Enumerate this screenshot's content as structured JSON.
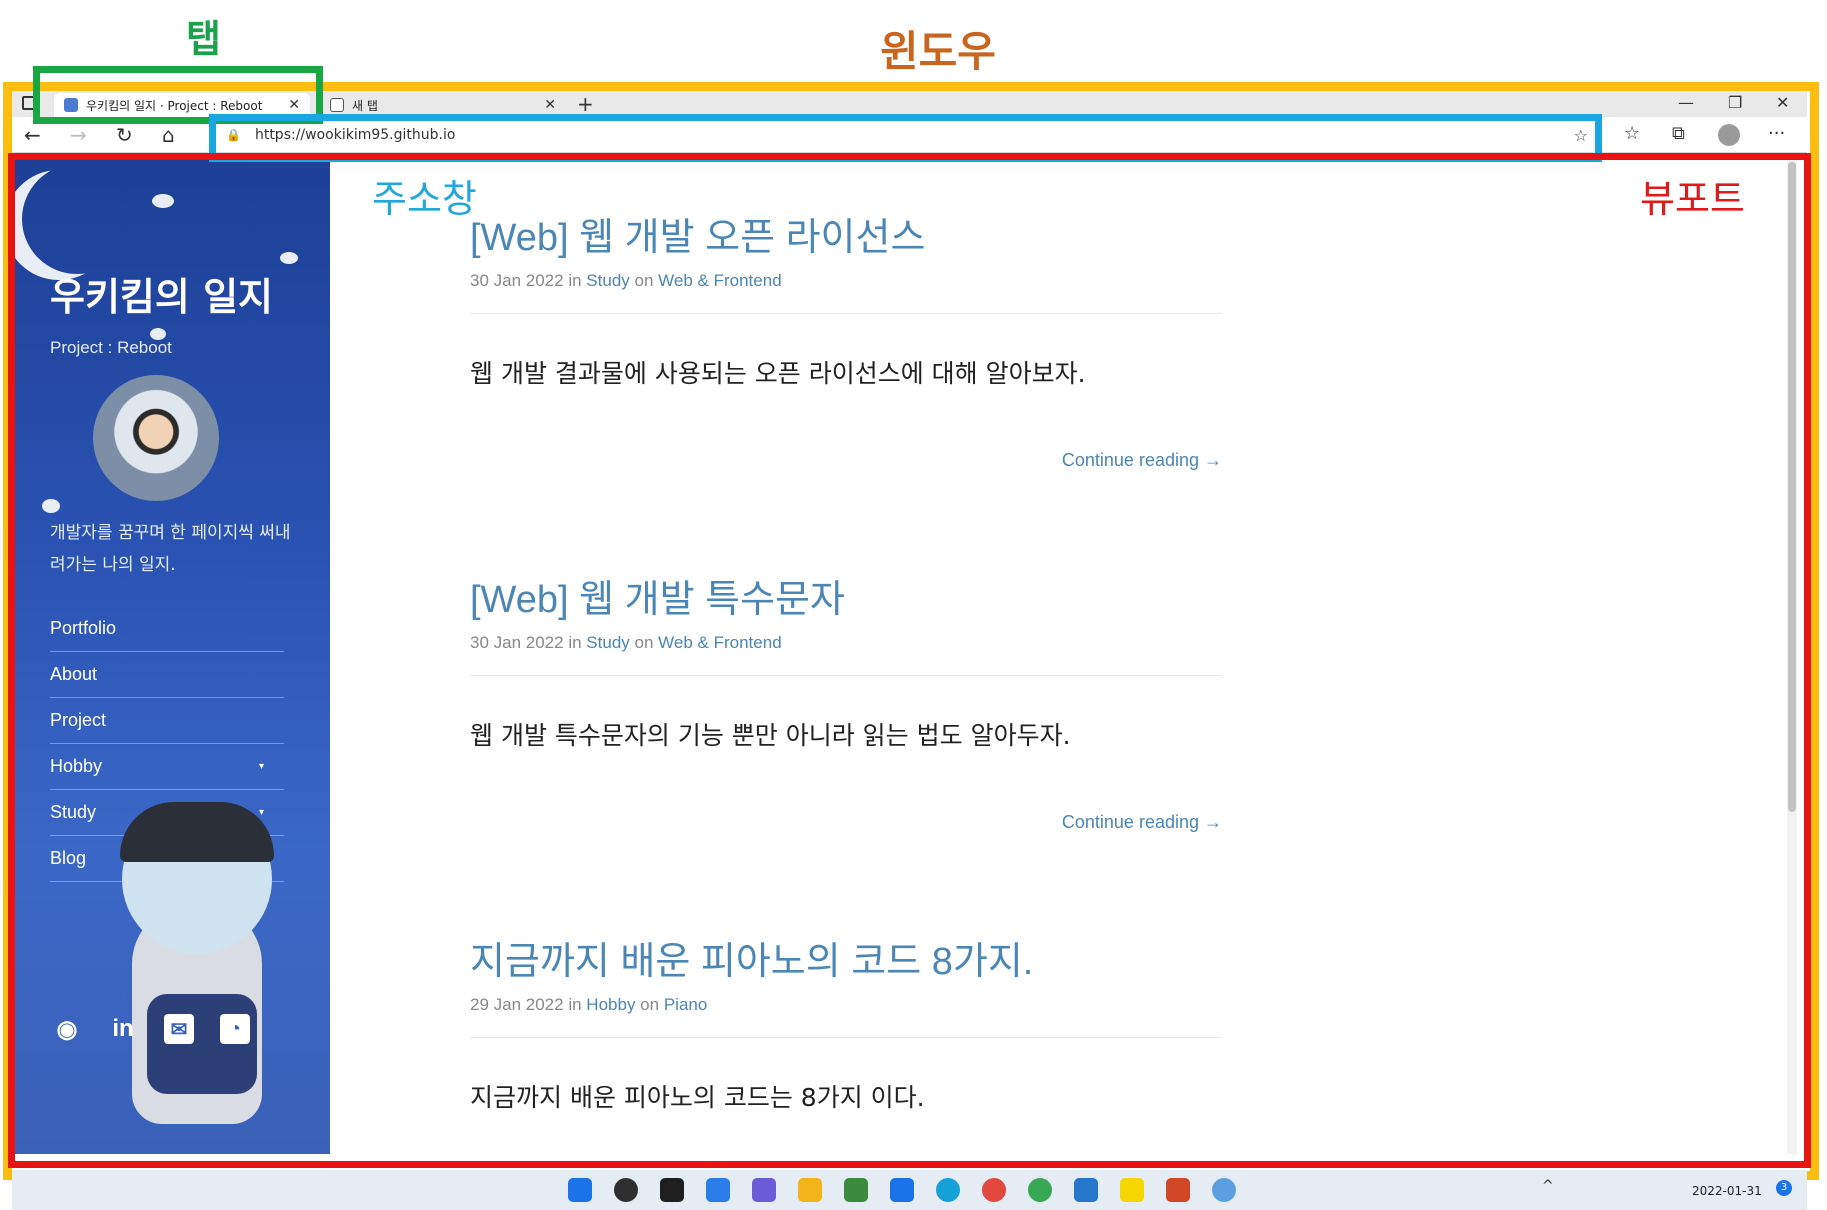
{
  "annotations": {
    "window_label": "윈도우",
    "tab_label": "탭",
    "address_label": "주소창",
    "viewport_label": "뷰포트",
    "colors": {
      "window": "#fbbd10",
      "tab": "#18a744",
      "address": "#1aa6e0",
      "viewport": "#e81414"
    }
  },
  "browser": {
    "tabs": [
      {
        "title": "우키킴의 일지 · Project : Reboot",
        "close": "✕"
      },
      {
        "title": "새 탭",
        "close": "✕"
      }
    ],
    "new_tab": "+",
    "window_controls": {
      "minimize": "—",
      "maximize": "❐",
      "close": "✕"
    },
    "nav": {
      "back": "←",
      "forward": "→",
      "reload": "↻",
      "home": "⌂"
    },
    "address": {
      "url": "https://wookikim95.github.io",
      "lock_icon": "🔒",
      "favorite_icon": "☆"
    },
    "toolbar": {
      "favorites": "☆",
      "collections": "⧉",
      "more": "···"
    }
  },
  "sidebar": {
    "title": "우키킴의 일지",
    "subtitle": "Project : Reboot",
    "description": "개발자를 꿈꾸며 한 페이지씩 써내려가는 나의 일지.",
    "nav": [
      {
        "label": "Portfolio",
        "caret": ""
      },
      {
        "label": "About",
        "caret": ""
      },
      {
        "label": "Project",
        "caret": ""
      },
      {
        "label": "Hobby",
        "caret": "▾"
      },
      {
        "label": "Study",
        "caret": "▾"
      },
      {
        "label": "Blog",
        "caret": ""
      }
    ],
    "social": [
      {
        "icon": "github-icon",
        "glyph": "◉"
      },
      {
        "icon": "linkedin-icon",
        "glyph": "in"
      },
      {
        "icon": "email-icon",
        "glyph": "✉"
      },
      {
        "icon": "rss-icon",
        "glyph": "◔"
      }
    ]
  },
  "posts": [
    {
      "title": "[Web] 웹 개발 오픈 라이선스",
      "date": "30 Jan 2022",
      "in": "in",
      "category": "Study",
      "on": "on",
      "tag": "Web & Frontend",
      "excerpt": "웹 개발 결과물에 사용되는 오픈 라이선스에 대해 알아보자.",
      "more": "Continue reading →"
    },
    {
      "title": "[Web] 웹 개발 특수문자",
      "date": "30 Jan 2022",
      "in": "in",
      "category": "Study",
      "on": "on",
      "tag": "Web & Frontend",
      "excerpt": "웹 개발 특수문자의 기능 뿐만 아니라 읽는 법도 알아두자.",
      "more": "Continue reading →"
    },
    {
      "title": "지금까지 배운 피아노의 코드 8가지.",
      "date": "29 Jan 2022",
      "in": "in",
      "category": "Hobby",
      "on": "on",
      "tag": "Piano",
      "excerpt": "지금까지 배운 피아노의 코드는 8가지 이다.",
      "more": ""
    }
  ],
  "taskbar": {
    "clock_date": "2022-01-31",
    "notification_count": "3",
    "tray_up": "^"
  }
}
